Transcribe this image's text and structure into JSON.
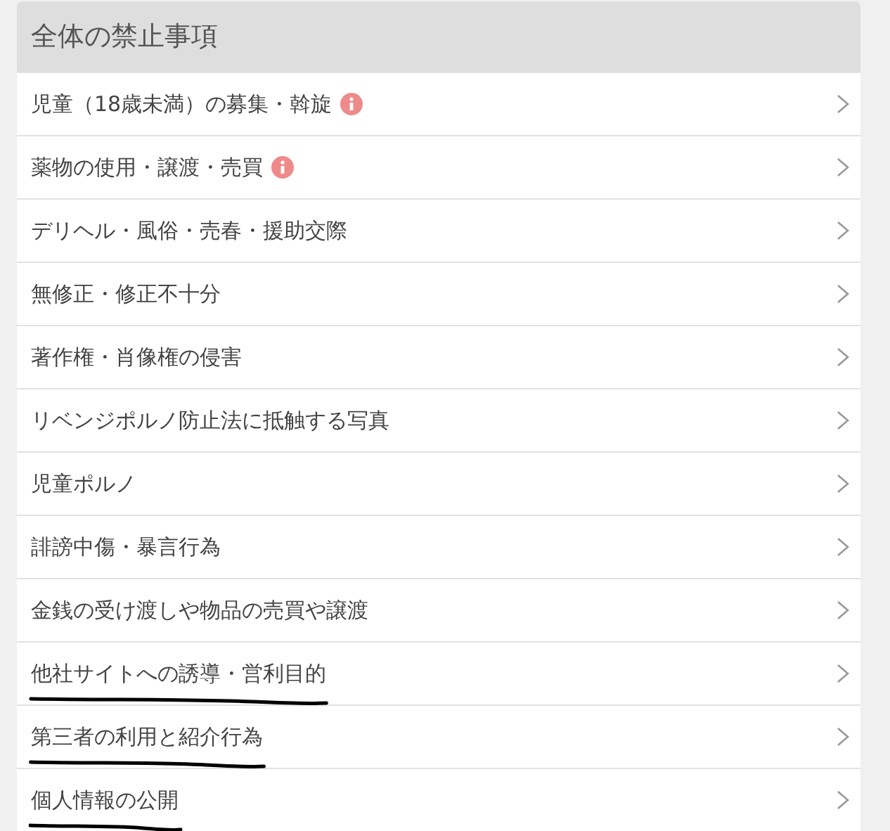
{
  "panel": {
    "title": "全体の禁止事項",
    "items": [
      {
        "label": "児童（18歳未満）の募集・斡旋",
        "info": true,
        "marked": false
      },
      {
        "label": "薬物の使用・譲渡・売買",
        "info": true,
        "marked": false
      },
      {
        "label": "デリヘル・風俗・売春・援助交際",
        "info": false,
        "marked": false
      },
      {
        "label": "無修正・修正不十分",
        "info": false,
        "marked": false
      },
      {
        "label": "著作権・肖像権の侵害",
        "info": false,
        "marked": false
      },
      {
        "label": "リベンジポルノ防止法に抵触する写真",
        "info": false,
        "marked": false
      },
      {
        "label": "児童ポルノ",
        "info": false,
        "marked": false
      },
      {
        "label": "誹謗中傷・暴言行為",
        "info": false,
        "marked": false
      },
      {
        "label": "金銭の受け渡しや物品の売買や譲渡",
        "info": false,
        "marked": false
      },
      {
        "label": "他社サイトへの誘導・営利目的",
        "info": false,
        "marked": true
      },
      {
        "label": "第三者の利用と紹介行為",
        "info": false,
        "marked": true
      },
      {
        "label": "個人情報の公開",
        "info": false,
        "marked": true
      }
    ]
  }
}
